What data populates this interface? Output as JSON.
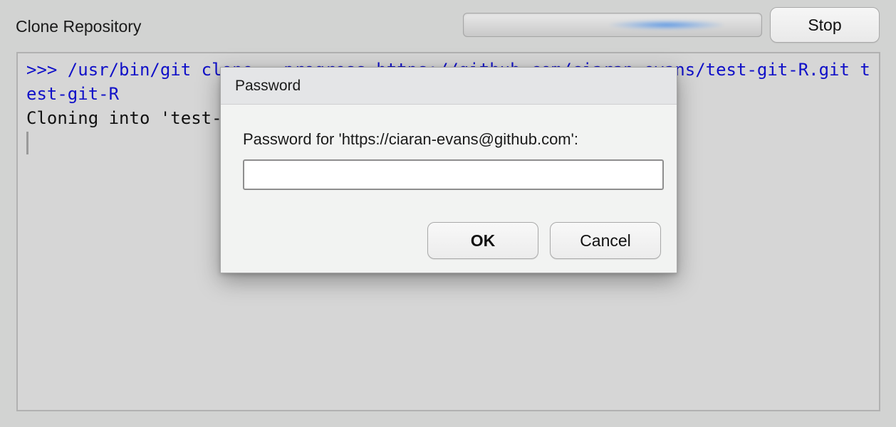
{
  "window": {
    "title": "Clone Repository",
    "stop_label": "Stop"
  },
  "console": {
    "command_line": ">>> /usr/bin/git clone --progress https://github.com/ciaran-evans/test-git-R.git test-git-R",
    "output_line": "Cloning into 'test-git-R'..."
  },
  "dialog": {
    "title": "Password",
    "prompt": "Password for 'https://ciaran-evans@github.com':",
    "password_value": "",
    "ok_label": "OK",
    "cancel_label": "Cancel"
  },
  "icons": {
    "progress_indicator": "indeterminate-progress-bar"
  },
  "colors": {
    "background": "#d2d3d2",
    "command_text": "#1010c8",
    "output_text": "#111111",
    "dialog_background": "#f2f3f2",
    "dialog_titlebar": "#e4e5e7",
    "progress_accent": "#468ce6"
  }
}
